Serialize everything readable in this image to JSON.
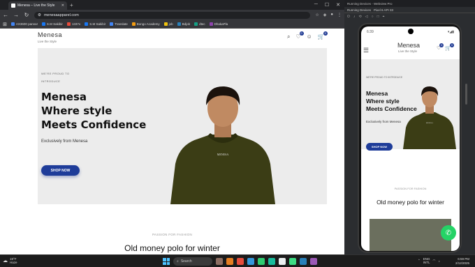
{
  "browser": {
    "tab_title": "Menesa – Live the Style",
    "url": "menesaapparel.com",
    "bookmarks": [
      {
        "label": "AX3600 panna!",
        "color": "#4285f4"
      },
      {
        "label": "S.M Sakibir",
        "color": "#1877f2"
      },
      {
        "label": "1337x",
        "color": "#e74c3c"
      },
      {
        "label": "S.M Sakibir",
        "color": "#1877f2"
      },
      {
        "label": "Translate",
        "color": "#4285f4"
      },
      {
        "label": "Bongo Academy",
        "color": "#f39c12"
      },
      {
        "label": "job",
        "color": "#f1c40f"
      },
      {
        "label": "Bdjob",
        "color": "#2980b9"
      },
      {
        "label": "dtec",
        "color": "#16a085"
      },
      {
        "label": "DhakaPla",
        "color": "#8e44ad"
      }
    ]
  },
  "site": {
    "brand": "Menesa",
    "tagline": "Live the Style",
    "wishlist_count": "0",
    "cart_count": "0",
    "hero": {
      "eyebrow": "WE'RE PROUD TO INTRODUCE",
      "headline_1": "Menesa",
      "headline_2": "Where style",
      "headline_3": "Meets Confidence",
      "subtitle": "Exclusively from Menesa",
      "cta": "SHOP NOW",
      "hoodie_print": "MENESA"
    },
    "section_eyebrow": "PASSION FOR FASHION",
    "section_title": "Old money polo for winter"
  },
  "studio": {
    "title": "Running Devices - Webview Pro",
    "panel_label": "Running Devices",
    "device_tab": "Pixel 6 API 33"
  },
  "phone": {
    "time": "6:39",
    "brand": "Menesa",
    "tagline": "Live the Style",
    "wishlist_count": "0",
    "cart_count": "0",
    "eyebrow": "WE'RE PROUD TO INTRODUCE",
    "headline_1": "Menesa",
    "headline_2": "Where style",
    "headline_3": "Meets Confidence",
    "subtitle": "Exclusively from Menesa",
    "cta": "SHOP NOW",
    "hoodie_print": "MENESA",
    "section_eyebrow": "PASSION FOR FASHION",
    "section_title": "Old money polo for winter"
  },
  "taskbar": {
    "temp": "19°F",
    "weather": "Haze",
    "search": "Search",
    "lang_1": "ENG",
    "lang_2": "INTL",
    "time": "6:59 PM",
    "date": "2/12/2025"
  },
  "colors": {
    "accent": "#1e3c99",
    "hoodie": "#3b3d15",
    "hero_bg": "#ececec",
    "whatsapp": "#25d366"
  }
}
